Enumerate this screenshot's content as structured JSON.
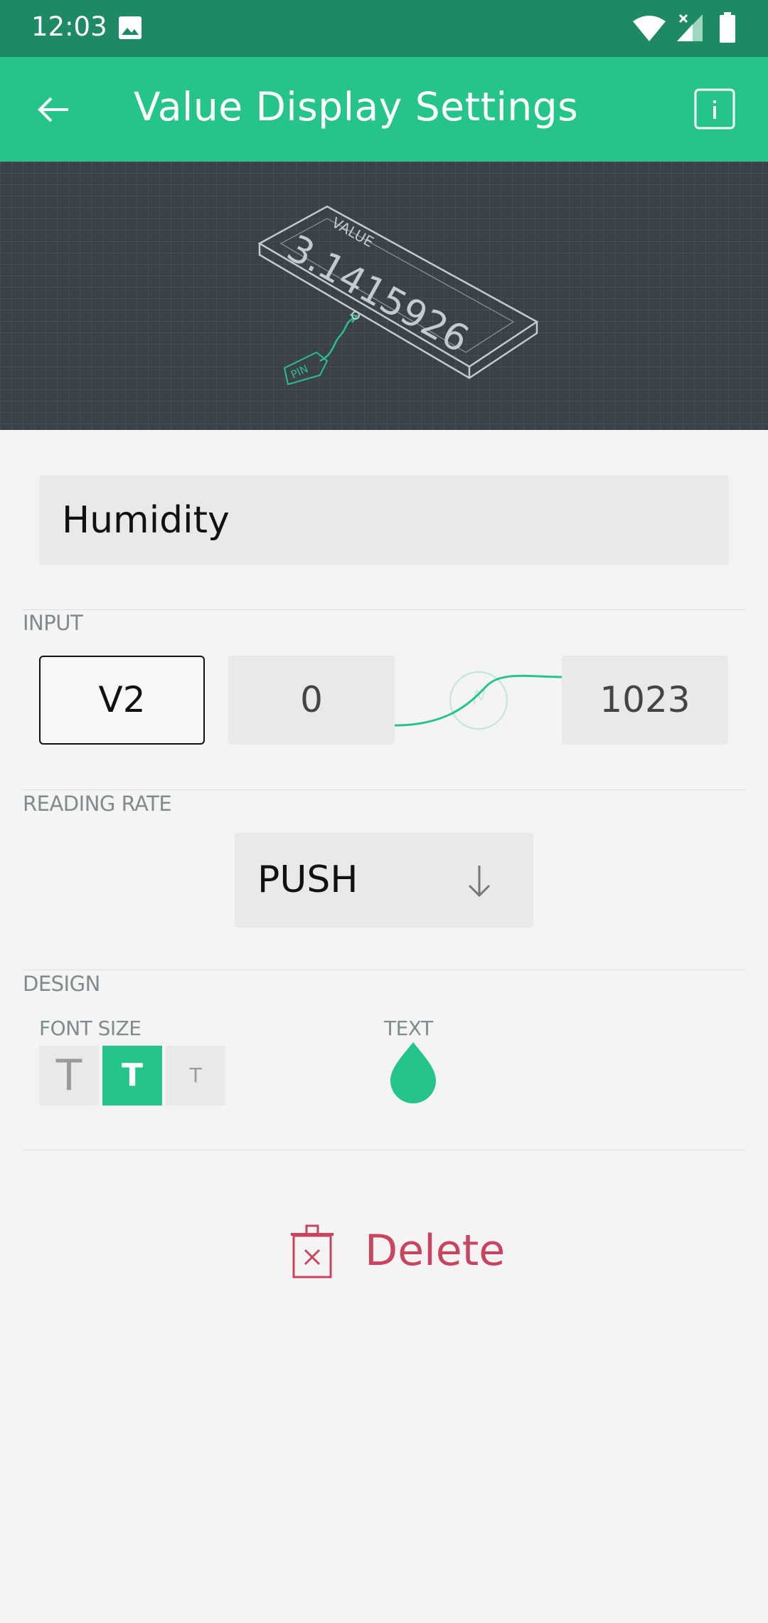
{
  "status_bar": {
    "time": "12:03",
    "icons": [
      "image-icon",
      "wifi-icon",
      "signal-icon",
      "battery-icon"
    ]
  },
  "app_bar": {
    "title": "Value Display Settings",
    "back_icon": "arrow-left-icon",
    "info_icon": "info-icon"
  },
  "preview": {
    "widget_label": "VALUE",
    "widget_value": "3.1415926",
    "pin_label": "PIN"
  },
  "name_field": {
    "value": "Humidity"
  },
  "input_section": {
    "label": "INPUT",
    "pin": "V2",
    "min": "0",
    "max": "1023"
  },
  "reading_rate": {
    "label": "READING RATE",
    "selected": "PUSH"
  },
  "design": {
    "label": "DESIGN",
    "font_size_label": "FONT SIZE",
    "font_sizes": [
      "T",
      "T",
      "T"
    ],
    "selected_font_size_index": 1,
    "text_color_label": "TEXT",
    "text_color": "#24c48b"
  },
  "delete": {
    "label": "Delete",
    "color": "#c8445f"
  },
  "colors": {
    "status_bar": "#1d8a63",
    "accent": "#24c48b",
    "preview_bg": "#3a4149"
  }
}
